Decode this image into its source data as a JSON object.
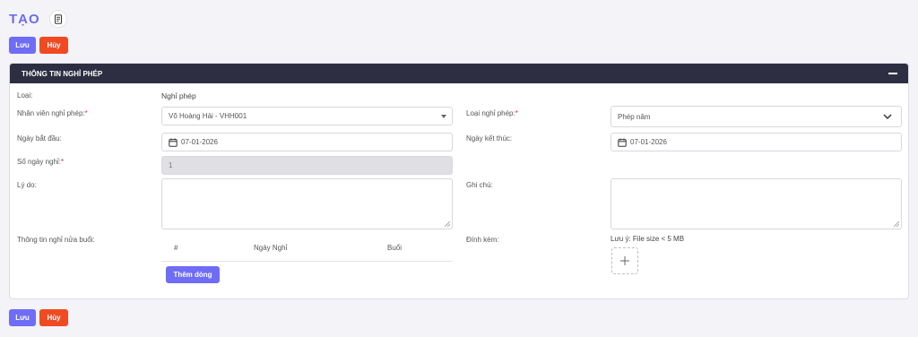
{
  "page": {
    "title": "TẠO"
  },
  "actions": {
    "save_label": "Lưu",
    "cancel_label": "Hủy"
  },
  "panel": {
    "title": "THÔNG TIN NGHỈ PHÉP",
    "type": {
      "label": "Loại:",
      "value": "Nghỉ phép"
    },
    "employee": {
      "label": "Nhân viên nghỉ phép:",
      "required_mark": "*",
      "value": "Võ Hoàng Hải - VHH001"
    },
    "leave_type": {
      "label": "Loại nghỉ phép:",
      "required_mark": "*",
      "value": "Phép năm"
    },
    "start_date": {
      "label": "Ngày bắt đầu:",
      "value": "07-01-2026"
    },
    "end_date": {
      "label": "Ngày kết thúc:",
      "value": "07-01-2026"
    },
    "days_off": {
      "label": "Số ngày nghỉ:",
      "required_mark": "*",
      "value": "1"
    },
    "reason": {
      "label": "Lý do:",
      "value": ""
    },
    "note": {
      "label": "Ghi chú:",
      "value": ""
    },
    "half_day": {
      "label": "Thông tin nghỉ nửa buổi:",
      "columns": [
        "#",
        "Ngày Nghỉ",
        "Buổi"
      ],
      "add_row_label": "Thêm dòng"
    },
    "attachment": {
      "label": "Đính kèm:",
      "hint": "Lưu ý: File size < 5 MB",
      "upload_icon": "plus-icon"
    }
  }
}
